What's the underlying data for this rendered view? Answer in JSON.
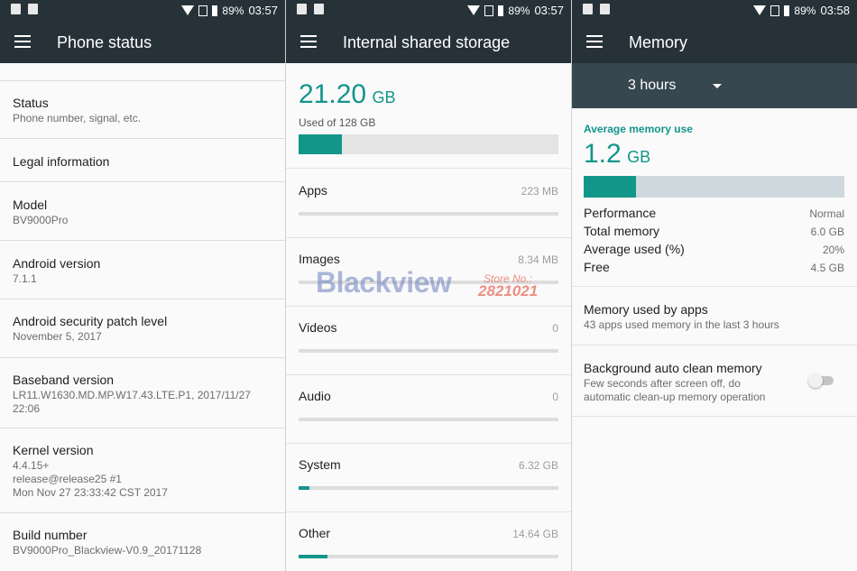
{
  "status_bars": [
    {
      "battery": "89%",
      "time": "03:57"
    },
    {
      "battery": "89%",
      "time": "03:57"
    },
    {
      "battery": "89%",
      "time": "03:58"
    }
  ],
  "phone_status": {
    "title": "Phone status",
    "items": [
      {
        "title": "Status",
        "subtitle": "Phone number, signal, etc."
      },
      {
        "title": "Legal information",
        "subtitle": ""
      },
      {
        "title": "Model",
        "subtitle": "BV9000Pro"
      },
      {
        "title": "Android version",
        "subtitle": "7.1.1"
      },
      {
        "title": "Android security patch level",
        "subtitle": "November 5, 2017"
      },
      {
        "title": "Baseband version",
        "subtitle_lines": [
          "LR11.W1630.MD.MP.W17.43.LTE.P1, 2017/11/27",
          "22:06"
        ]
      },
      {
        "title": "Kernel version",
        "subtitle_lines": [
          "4.4.15+",
          "release@release25 #1",
          "Mon Nov 27 23:33:42 CST 2017"
        ]
      },
      {
        "title": "Build number",
        "subtitle": "BV9000Pro_Blackview-V0.9_20171128"
      }
    ]
  },
  "storage": {
    "title": "Internal shared storage",
    "used_value": "21.20",
    "used_unit": "GB",
    "used_of": "Used of 128 GB",
    "used_fraction": 0.166,
    "items": [
      {
        "label": "Apps",
        "size": "223 MB",
        "fraction": 0.0
      },
      {
        "label": "Images",
        "size": "8.34 MB",
        "fraction": 0.0
      },
      {
        "label": "Videos",
        "size": "0",
        "fraction": 0.0
      },
      {
        "label": "Audio",
        "size": "0",
        "fraction": 0.0
      },
      {
        "label": "System",
        "size": "6.32 GB",
        "fraction": 0.04
      },
      {
        "label": "Other",
        "size": "14.64 GB",
        "fraction": 0.11
      }
    ]
  },
  "memory": {
    "title": "Memory",
    "period": "3 hours",
    "avg_label": "Average memory use",
    "avg_value": "1.2",
    "avg_unit": "GB",
    "avg_fraction": 0.2,
    "stats": [
      {
        "label": "Performance",
        "value": "Normal"
      },
      {
        "label": "Total memory",
        "value": "6.0 GB"
      },
      {
        "label": "Average used (%)",
        "value": "20%"
      },
      {
        "label": "Free",
        "value": "4.5 GB"
      }
    ],
    "apps_title": "Memory used by apps",
    "apps_subtitle": "43 apps used memory in the last 3 hours",
    "clean_title": "Background auto clean memory",
    "clean_subtitle_1": "Few seconds after screen off, do",
    "clean_subtitle_2": "automatic clean-up memory operation",
    "clean_enabled": false
  },
  "watermark": {
    "brand": "Blackview",
    "store": "Store No.:",
    "code": "2821021"
  },
  "colors": {
    "accent": "#13968a",
    "appbar": "#263238"
  }
}
